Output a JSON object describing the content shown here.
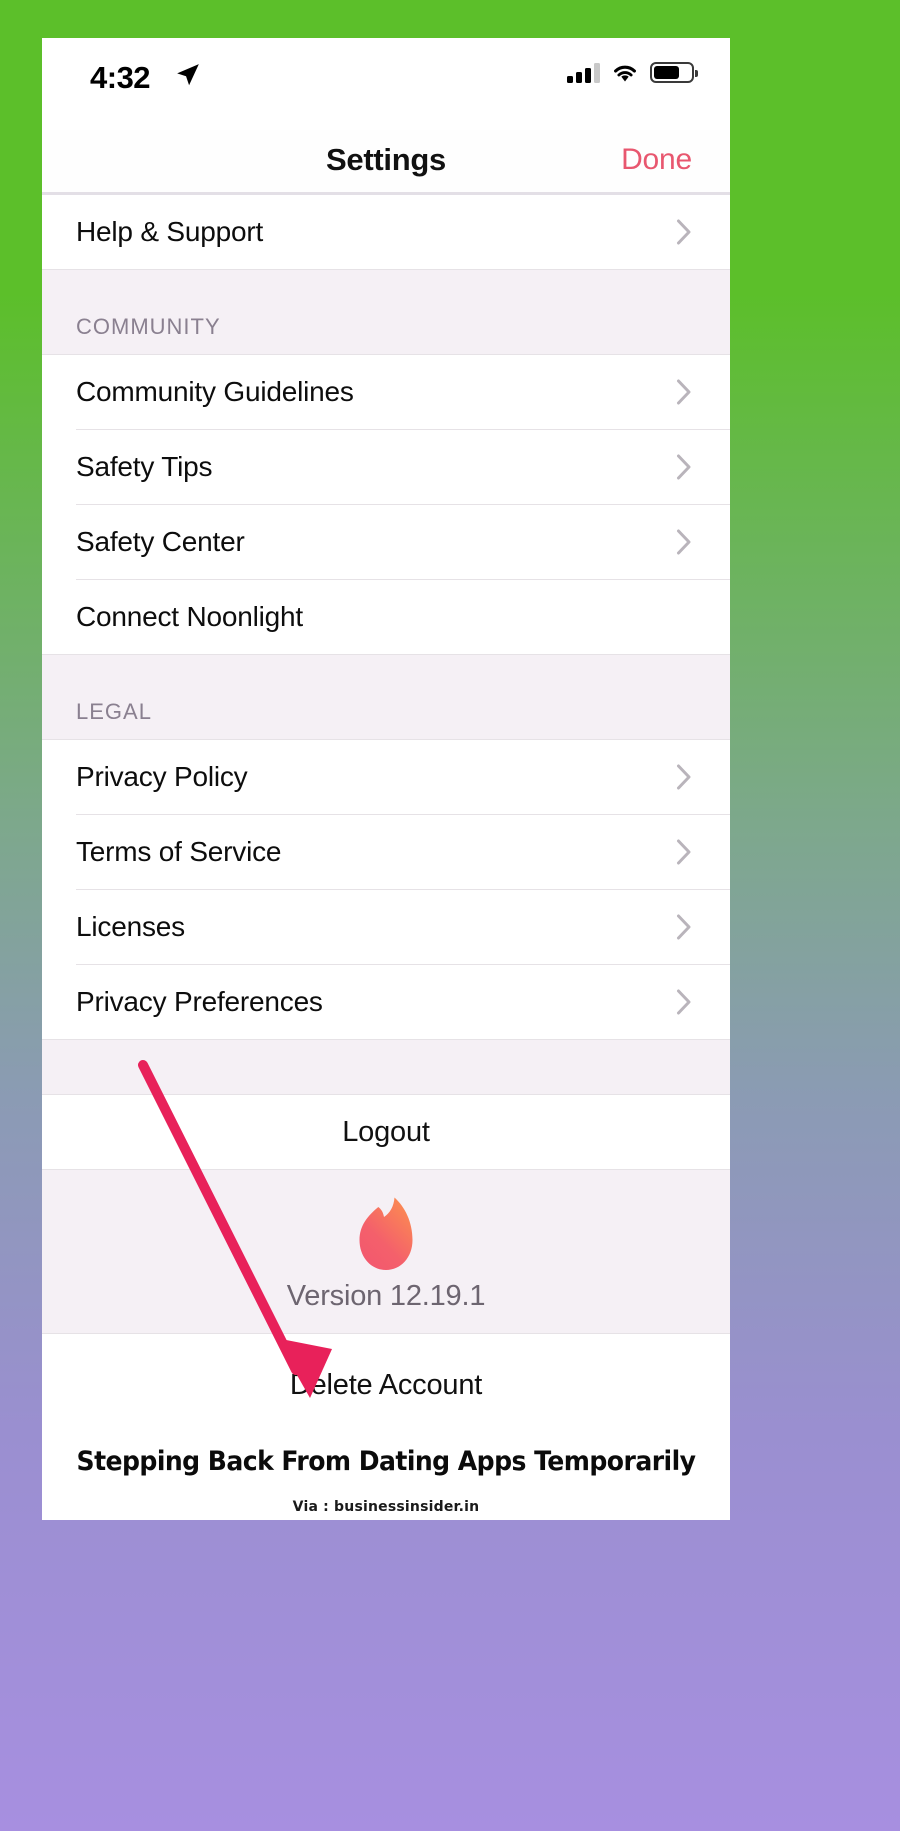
{
  "status_bar": {
    "time": "4:32",
    "location_icon": "location-arrow-icon",
    "cellular_icon": "cellular-signal-icon",
    "wifi_icon": "wifi-icon",
    "battery_icon": "battery-icon",
    "battery_level_percent": 70
  },
  "nav": {
    "title": "Settings",
    "done_label": "Done",
    "done_color": "#e8576f"
  },
  "sections": [
    {
      "header": null,
      "rows": [
        {
          "label": "Help & Support",
          "chevron": true
        }
      ]
    },
    {
      "header": "COMMUNITY",
      "rows": [
        {
          "label": "Community Guidelines",
          "chevron": true
        },
        {
          "label": "Safety Tips",
          "chevron": true
        },
        {
          "label": "Safety Center",
          "chevron": true
        },
        {
          "label": "Connect Noonlight",
          "chevron": false
        }
      ]
    },
    {
      "header": "LEGAL",
      "rows": [
        {
          "label": "Privacy Policy",
          "chevron": true
        },
        {
          "label": "Terms of Service",
          "chevron": true
        },
        {
          "label": "Licenses",
          "chevron": true
        },
        {
          "label": "Privacy Preferences",
          "chevron": true
        }
      ]
    }
  ],
  "logout_label": "Logout",
  "brand": {
    "logo_icon": "tinder-flame-icon",
    "logo_gradient_start": "#ff7854",
    "logo_gradient_end": "#fd267d",
    "version_label": "Version 12.19.1"
  },
  "delete_account_label": "Delete Account",
  "caption": {
    "headline": "Stepping Back From Dating Apps Temporarily",
    "attribution": "Via : businessinsider.in"
  },
  "annotation": {
    "arrow_icon": "red-pointer-arrow-icon",
    "arrow_color": "#e8215a",
    "points_to": "Delete Account"
  },
  "background": {
    "gradient_top": "#5cbf2a",
    "gradient_bottom": "#a78fe0"
  }
}
